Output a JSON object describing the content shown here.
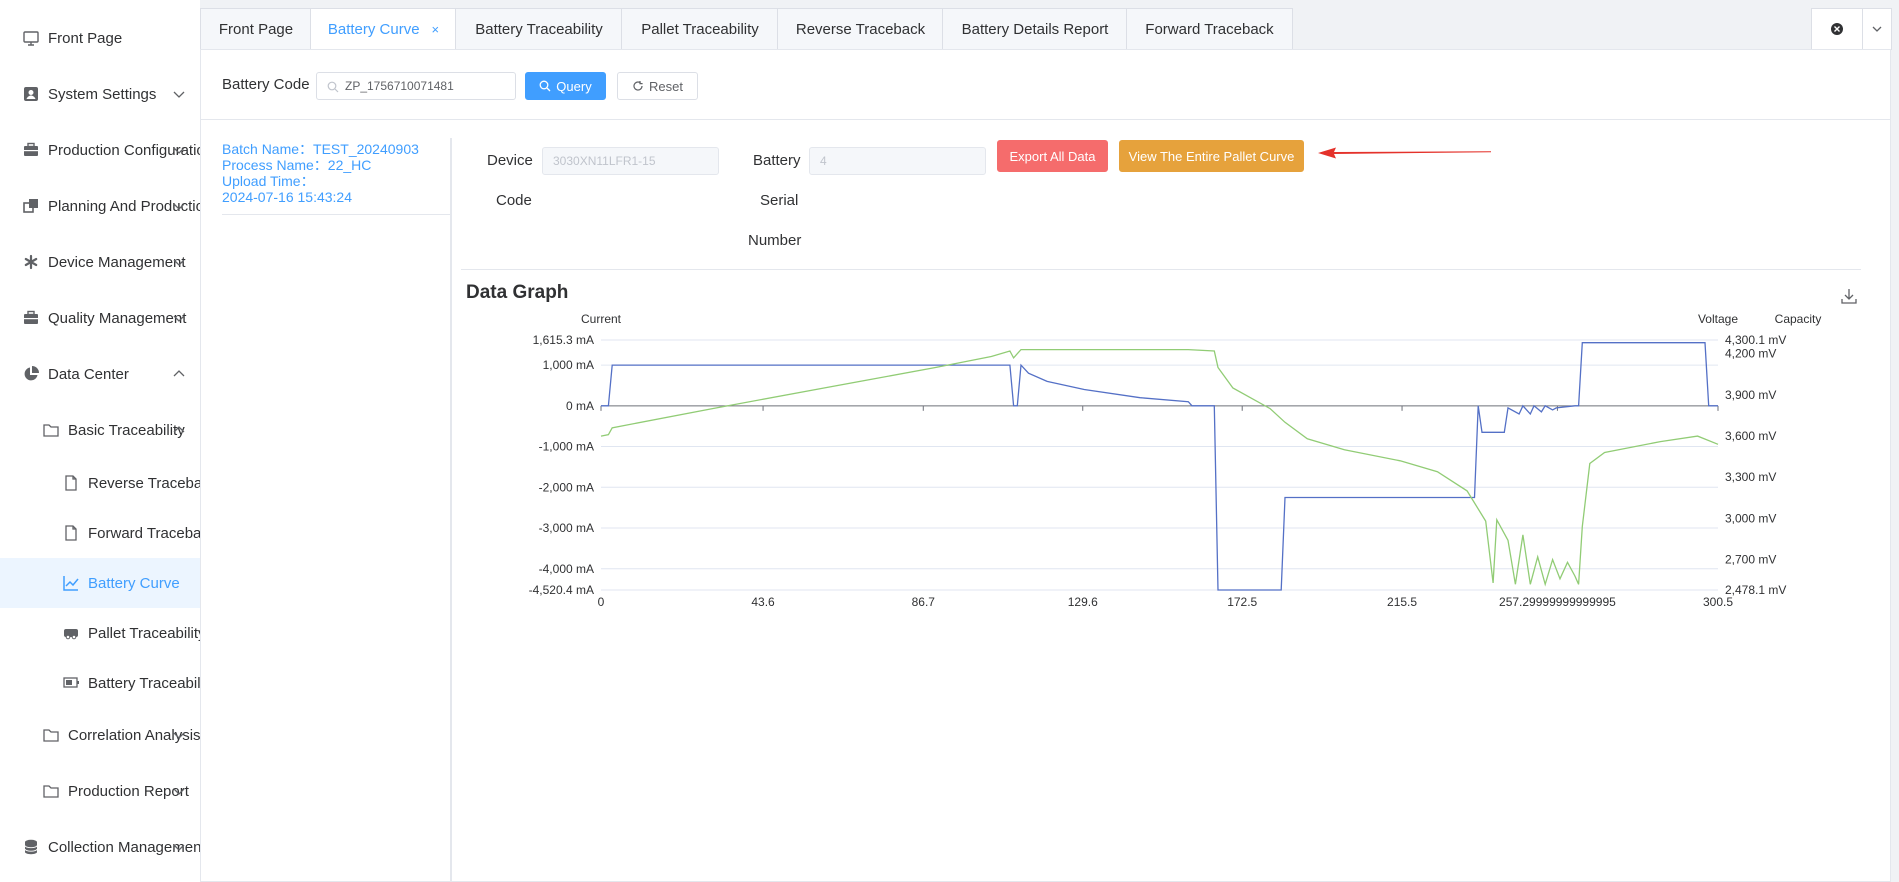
{
  "sidebar": {
    "items": [
      {
        "label": "Front Page"
      },
      {
        "label": "System Settings"
      },
      {
        "label": "Production Configuration"
      },
      {
        "label": "Planning And Production"
      },
      {
        "label": "Device Management"
      },
      {
        "label": "Quality Management"
      },
      {
        "label": "Data Center"
      },
      {
        "label": "Basic Traceability"
      },
      {
        "label": "Reverse Traceback"
      },
      {
        "label": "Forward Traceback"
      },
      {
        "label": "Battery Curve"
      },
      {
        "label": "Pallet Traceability"
      },
      {
        "label": "Battery Traceability"
      },
      {
        "label": "Correlation Analysis"
      },
      {
        "label": "Production Report"
      },
      {
        "label": "Collection Management"
      }
    ]
  },
  "tabs": [
    {
      "label": "Front Page"
    },
    {
      "label": "Battery Curve",
      "close": "×"
    },
    {
      "label": "Battery Traceability"
    },
    {
      "label": "Pallet Traceability"
    },
    {
      "label": "Reverse Traceback"
    },
    {
      "label": "Battery Details Report"
    },
    {
      "label": "Forward Traceback"
    }
  ],
  "query": {
    "label": "Battery Code",
    "value": "ZP_1756710071481",
    "query_btn": "Query",
    "reset_btn": "Reset"
  },
  "batch": {
    "name": "Batch Name：TEST_20240903",
    "process": "Process Name：22_HC",
    "upload_label": "Upload Time：",
    "upload_time": "2024-07-16 15:43:24"
  },
  "device": {
    "label_line1": "Device",
    "label_line2": "Code",
    "placeholder": "3030XN11LFR1-15"
  },
  "serial": {
    "label_line1": "Battery",
    "label_line2": "Serial",
    "label_line3": "Number",
    "placeholder": "4"
  },
  "actions": {
    "export": "Export All Data",
    "pallet_curve": "View The Entire Pallet Curve"
  },
  "chart_data": {
    "type": "line",
    "title": "Data Graph",
    "axes": {
      "left": {
        "name": "Current",
        "min": -4520.4,
        "max": 1615.3,
        "ticks": [
          "1,615.3 mA",
          "1,000 mA",
          "0 mA",
          "-1,000 mA",
          "-2,000 mA",
          "-3,000 mA",
          "-4,000 mA",
          "-4,520.4 mA"
        ],
        "tick_values": [
          1615.3,
          1000,
          0,
          -1000,
          -2000,
          -3000,
          -4000,
          -4520.4
        ]
      },
      "right": {
        "name": "Voltage",
        "min": 2478.1,
        "max": 4300.1,
        "ticks": [
          "4,300.1 mV",
          "4,200 mV",
          "3,900 mV",
          "3,600 mV",
          "3,300 mV",
          "3,000 mV",
          "2,700 mV",
          "2,478.1 mV"
        ],
        "tick_values": [
          4300.1,
          4200,
          3900,
          3600,
          3300,
          3000,
          2700,
          2478.1
        ]
      },
      "right2": {
        "name": "Capacity"
      },
      "x": {
        "min": 0,
        "max": 300.5,
        "ticks": [
          "0",
          "43.6",
          "86.7",
          "129.6",
          "172.5",
          "215.5",
          "257.29999999999995",
          "300.5"
        ],
        "tick_values": [
          0,
          43.6,
          86.7,
          129.6,
          172.5,
          215.5,
          257.3,
          300.5
        ]
      }
    },
    "grid": true,
    "series": [
      {
        "axis": "left",
        "color": "#5470c6",
        "points": [
          [
            0,
            0
          ],
          [
            2,
            0
          ],
          [
            3,
            1000
          ],
          [
            30,
            1000
          ],
          [
            60,
            1000
          ],
          [
            90,
            1000
          ],
          [
            110,
            1000
          ],
          [
            111,
            0
          ],
          [
            112,
            0
          ],
          [
            113,
            1000
          ],
          [
            115,
            800
          ],
          [
            120,
            600
          ],
          [
            130,
            400
          ],
          [
            145,
            200
          ],
          [
            158,
            100
          ],
          [
            159,
            0
          ],
          [
            165,
            0
          ],
          [
            166,
            -4520
          ],
          [
            183,
            -4520
          ],
          [
            184,
            -2250
          ],
          [
            190,
            -2250
          ],
          [
            230,
            -2250
          ],
          [
            235,
            -2250
          ],
          [
            236,
            0
          ],
          [
            237,
            -650
          ],
          [
            243,
            -650
          ],
          [
            244,
            -50
          ],
          [
            247,
            -200
          ],
          [
            248,
            0
          ],
          [
            250,
            -200
          ],
          [
            251,
            0
          ],
          [
            253,
            -150
          ],
          [
            254,
            0
          ],
          [
            256,
            -100
          ],
          [
            257,
            -50
          ],
          [
            262,
            0
          ],
          [
            263,
            0
          ],
          [
            264,
            1550
          ],
          [
            284,
            1550
          ],
          [
            297,
            1550
          ],
          [
            298,
            0
          ],
          [
            300.5,
            0
          ]
        ]
      },
      {
        "axis": "right",
        "color": "#91cc75",
        "points": [
          [
            0,
            3600
          ],
          [
            2,
            3610
          ],
          [
            3,
            3660
          ],
          [
            30,
            3800
          ],
          [
            60,
            3950
          ],
          [
            90,
            4100
          ],
          [
            105,
            4180
          ],
          [
            110,
            4220
          ],
          [
            111,
            4170
          ],
          [
            112,
            4200
          ],
          [
            113,
            4230
          ],
          [
            125,
            4230
          ],
          [
            140,
            4230
          ],
          [
            158,
            4230
          ],
          [
            165,
            4220
          ],
          [
            166,
            4100
          ],
          [
            170,
            3950
          ],
          [
            180,
            3800
          ],
          [
            184,
            3700
          ],
          [
            190,
            3580
          ],
          [
            200,
            3500
          ],
          [
            215,
            3420
          ],
          [
            225,
            3340
          ],
          [
            233,
            3200
          ],
          [
            238,
            2980
          ],
          [
            240,
            2530
          ],
          [
            241,
            2990
          ],
          [
            244,
            2840
          ],
          [
            246,
            2520
          ],
          [
            248,
            2880
          ],
          [
            250,
            2520
          ],
          [
            252,
            2720
          ],
          [
            254,
            2520
          ],
          [
            256,
            2700
          ],
          [
            258,
            2560
          ],
          [
            260,
            2680
          ],
          [
            262,
            2580
          ],
          [
            263,
            2520
          ],
          [
            264,
            2940
          ],
          [
            266,
            3400
          ],
          [
            270,
            3480
          ],
          [
            285,
            3560
          ],
          [
            295,
            3600
          ],
          [
            300.5,
            3540
          ]
        ]
      }
    ]
  }
}
